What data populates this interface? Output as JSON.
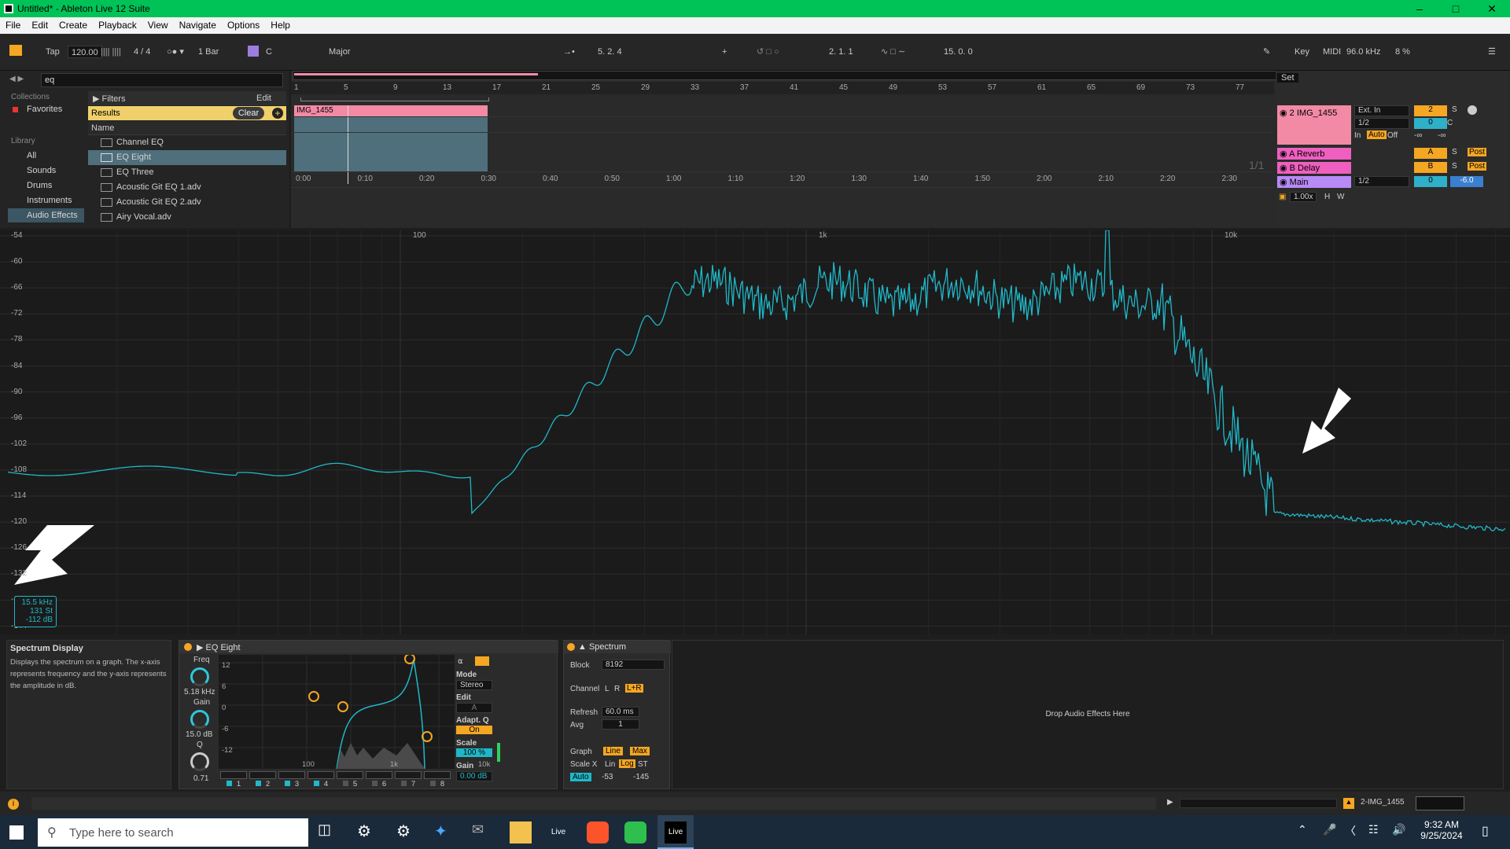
{
  "window": {
    "title": "Untitled* - Ableton Live 12 Suite"
  },
  "menu": [
    "File",
    "Edit",
    "Create",
    "Playback",
    "View",
    "Navigate",
    "Options",
    "Help"
  ],
  "control_bar": {
    "tap": "Tap",
    "tempo": "120.00",
    "signature": "4 / 4",
    "quant": "1 Bar",
    "key": "C",
    "scale": "Major",
    "position": "5.  2.  4",
    "loop_start": "2.  1.  1",
    "loop_len": "15.  0.  0",
    "key_label": "Key",
    "midi_label": "MIDI",
    "sample_rate": "96.0 kHz",
    "cpu": "8 %"
  },
  "browser": {
    "search": "eq",
    "collections_label": "Collections",
    "favorites": "Favorites",
    "library_label": "Library",
    "library_items": [
      "All",
      "Sounds",
      "Drums",
      "Instruments",
      "Audio Effects"
    ],
    "filters": "Filters",
    "edit": "Edit",
    "results": "Results",
    "clear": "Clear",
    "name_header": "Name",
    "items": [
      "Channel EQ",
      "EQ Eight",
      "EQ Three",
      "Acoustic Git EQ 1.adv",
      "Acoustic Git EQ 2.adv",
      "Airy Vocal.adv"
    ]
  },
  "arrangement": {
    "bars": [
      "1",
      "5",
      "9",
      "13",
      "17",
      "21",
      "25",
      "29",
      "33",
      "37",
      "41",
      "45",
      "49",
      "53",
      "57",
      "61",
      "65",
      "69",
      "73",
      "77"
    ],
    "times": [
      "0:00",
      "0:10",
      "0:20",
      "0:30",
      "0:40",
      "0:50",
      "1:00",
      "1:10",
      "1:20",
      "1:30",
      "1:40",
      "1:50",
      "2:00",
      "2:10",
      "2:20",
      "2:30"
    ],
    "clip_name": "IMG_1455",
    "page": "1/1",
    "set_label": "Set",
    "tracks": [
      {
        "name": "2 IMG_1455",
        "input": "Ext. In",
        "channel": "1/2",
        "num": "2",
        "vol": "0",
        "pan": "C",
        "color": "#f28aa6",
        "monitor": "Auto",
        "in": "In",
        "off": "Off",
        "meter_a": "-∞",
        "meter_b": "-∞",
        "solo": "S"
      },
      {
        "name": "A Reverb",
        "letter": "A",
        "color": "#ee5fc0",
        "solo": "S",
        "post": "Post"
      },
      {
        "name": "B Delay",
        "letter": "B",
        "color": "#ee5fc0",
        "solo": "S",
        "post": "Post"
      },
      {
        "name": "Main",
        "channel": "1/2",
        "vol": "0",
        "pan": "-6.0",
        "color": "#b88af5"
      }
    ],
    "zoom": "1.00x",
    "h": "H",
    "w": "W"
  },
  "spectrum_view": {
    "db_labels": [
      "-54",
      "-60",
      "-66",
      "-72",
      "-78",
      "-84",
      "-90",
      "-96",
      "-102",
      "-108",
      "-114",
      "-120",
      "-126",
      "-132",
      "-138",
      "-144"
    ],
    "freq_labels": [
      "100",
      "1k",
      "10k"
    ],
    "readout": {
      "freq": "15.5 kHz",
      "st": "131 St",
      "db": "-112 dB"
    }
  },
  "info": {
    "title": "Spectrum Display",
    "text": "Displays the spectrum on a graph. The x-axis represents frequency and the y-axis represents the amplitude in dB."
  },
  "eq_eight": {
    "title": "EQ Eight",
    "freq_label": "Freq",
    "freq": "5.18 kHz",
    "gain_label": "Gain",
    "gain": "15.0 dB",
    "q_label": "Q",
    "q": "0.71",
    "y_labels": [
      "12",
      "6",
      "0",
      "-6",
      "-12"
    ],
    "x_labels": [
      "100",
      "1k",
      "10k"
    ],
    "mode_label": "Mode",
    "mode": "Stereo",
    "edit_label": "Edit",
    "edit_val": "A",
    "adapt_label": "Adapt. Q",
    "adapt": "On",
    "scale_label": "Scale",
    "scale": "100 %",
    "gain_out_label": "Gain",
    "gain_out": "0.00 dB",
    "bands": [
      "1",
      "2",
      "3",
      "4",
      "5",
      "6",
      "7",
      "8"
    ]
  },
  "spectrum_device": {
    "title": "Spectrum",
    "block_label": "Block",
    "block": "8192",
    "channel_label": "Channel",
    "ch_l": "L",
    "ch_r": "R",
    "ch_lr": "L+R",
    "refresh_label": "Refresh",
    "refresh": "60.0 ms",
    "avg_label": "Avg",
    "avg": "1",
    "graph_label": "Graph",
    "graph_line": "Line",
    "graph_max": "Max",
    "scalex_label": "Scale X",
    "lin": "Lin",
    "log": "Log",
    "st": "ST",
    "auto": "Auto",
    "range_lo": "-53",
    "range_hi": "-145"
  },
  "dropzone": "Drop Audio Effects Here",
  "status": {
    "track": "2-IMG_1455"
  },
  "taskbar": {
    "search": "Type here to search",
    "time": "9:32 AM",
    "date": "9/25/2024"
  },
  "colors": {
    "accent": "#f5a623",
    "spectrum": "#20b8c8",
    "clip": "#f28aa6",
    "titlebar": "#00c357"
  }
}
